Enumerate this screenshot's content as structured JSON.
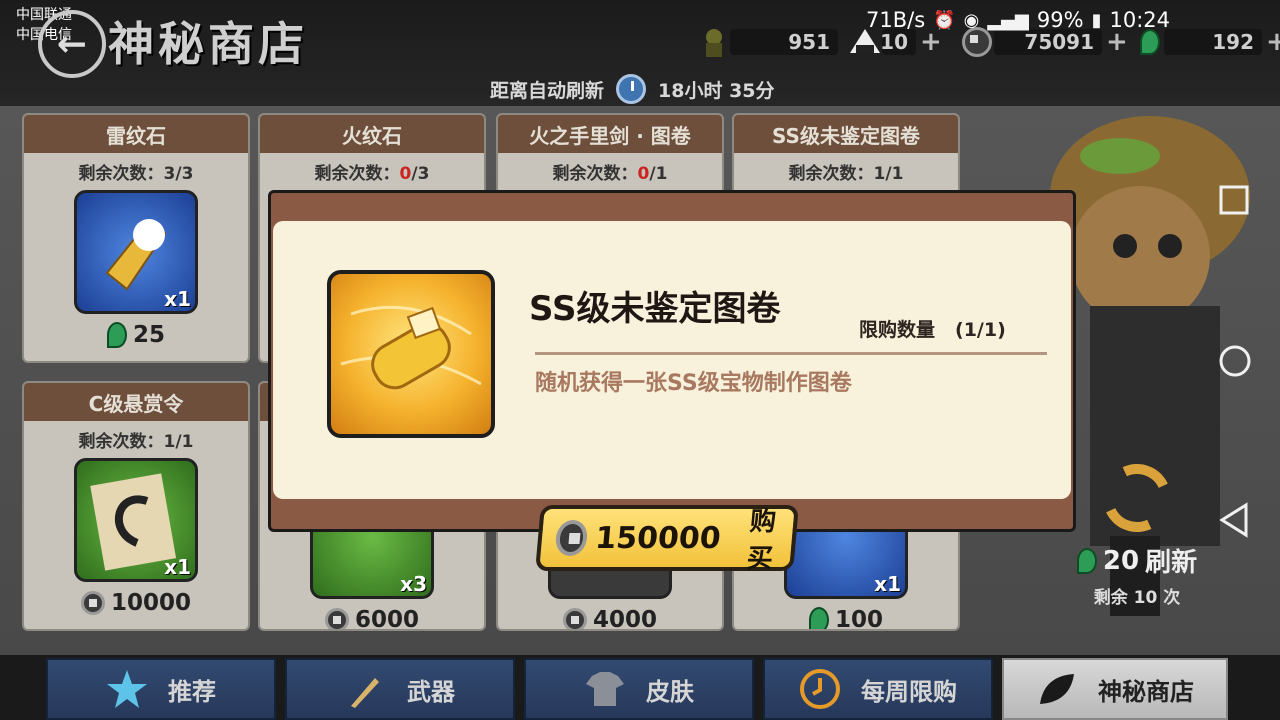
{
  "status_bar": {
    "carrier_1": "中国联通",
    "carrier_2": "中国电信",
    "speed": "71B/s",
    "battery": "99%",
    "time": "10:24"
  },
  "header": {
    "title": "神秘商店",
    "refresh_label": "距离自动刷新",
    "refresh_time": "18小时 35分"
  },
  "currencies": [
    {
      "icon": "ninja-figure-icon",
      "value": "951"
    },
    {
      "icon": "onigiri-icon",
      "value": "10"
    },
    {
      "icon": "coin-icon",
      "value": "75091"
    },
    {
      "icon": "jade-icon",
      "value": "192"
    }
  ],
  "cards": [
    {
      "title": "雷纹石",
      "remaining_label": "剩余次数：",
      "remaining_used": "3",
      "remaining_total": "/3",
      "qty": "x1",
      "price": "25",
      "currency": "jade"
    },
    {
      "title": "火纹石",
      "remaining_label": "剩余次数：",
      "remaining_used": "0",
      "remaining_total": "/3",
      "qty": "",
      "price": "",
      "currency": ""
    },
    {
      "title": "火之手里剑 · 图卷",
      "remaining_label": "剩余次数：",
      "remaining_used": "0",
      "remaining_total": "/1",
      "qty": "",
      "price": "",
      "currency": ""
    },
    {
      "title": "SS级未鉴定图卷",
      "remaining_label": "剩余次数：",
      "remaining_used": "1",
      "remaining_total": "/1",
      "qty": "",
      "price": "",
      "currency": ""
    },
    {
      "title": "C级悬赏令",
      "remaining_label": "剩余次数：",
      "remaining_used": "1",
      "remaining_total": "/1",
      "qty": "x1",
      "price": "10000",
      "currency": "coin"
    },
    {
      "title": "",
      "remaining_label": "",
      "remaining_used": "",
      "remaining_total": "",
      "qty": "x3",
      "price": "6000",
      "currency": "coin"
    },
    {
      "title": "",
      "remaining_label": "",
      "remaining_used": "",
      "remaining_total": "",
      "qty": "",
      "price": "4000",
      "currency": "coin"
    },
    {
      "title": "",
      "remaining_label": "",
      "remaining_used": "",
      "remaining_total": "",
      "qty": "x1",
      "price": "100",
      "currency": "jade"
    }
  ],
  "modal": {
    "item_name": "SS级未鉴定图卷",
    "limit_label": "限购数量",
    "limit_value": "(1/1)",
    "description": "随机获得一张SS级宝物制作图卷",
    "price": "150000",
    "buy_label": "购买"
  },
  "refresh_panel": {
    "cost": "20",
    "label": "刷新",
    "remaining": "剩余 10 次"
  },
  "tabs": [
    {
      "label": "推荐",
      "icon": "star-icon",
      "active": false
    },
    {
      "label": "武器",
      "icon": "sword-icon",
      "active": false
    },
    {
      "label": "皮肤",
      "icon": "shirt-icon",
      "active": false
    },
    {
      "label": "每周限购",
      "icon": "weekly-clock-icon",
      "active": false
    },
    {
      "label": "神秘商店",
      "icon": "leaf-icon",
      "active": true
    }
  ],
  "colors": {
    "card_header": "#6e4f3c",
    "modal_frame": "#8a5a44",
    "modal_bg": "#f8f1dc",
    "buy_button": "#f2c23a",
    "tab_blue": "#324a71",
    "remaining_zero": "#cc2222"
  }
}
